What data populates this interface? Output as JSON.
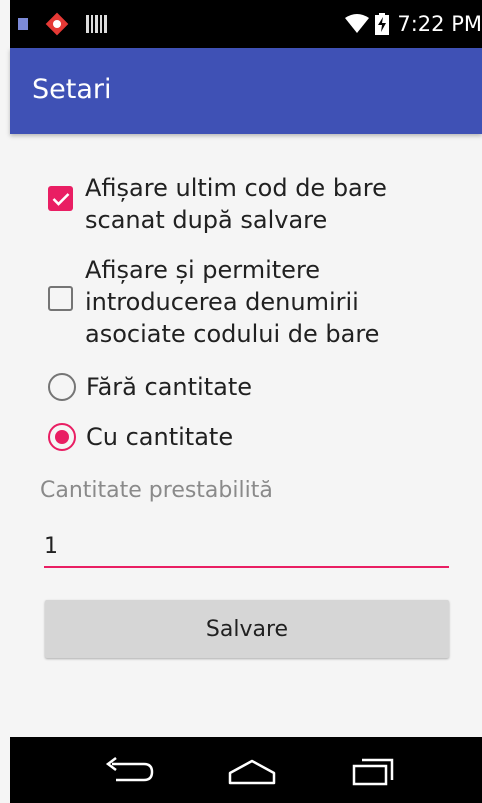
{
  "status_bar": {
    "time": "7:22 PM",
    "icons": [
      "notification-square-icon",
      "app-diamond-icon",
      "barcode-icon",
      "wifi-icon",
      "battery-charging-icon"
    ]
  },
  "app_bar": {
    "title": "Setari"
  },
  "settings": {
    "checkbox_last_code": {
      "lines": [
        "Afișare ultim cod de bare",
        "scanat după salvare"
      ],
      "checked": true
    },
    "checkbox_name_entry": {
      "lines": [
        "Afișare și permitere",
        "introducerea denumirii",
        "asociate codului de bare"
      ],
      "checked": false
    },
    "radio_no_quantity": {
      "label": "Fără cantitate",
      "selected": false
    },
    "radio_with_quantity": {
      "label": "Cu cantitate",
      "selected": true
    },
    "default_quantity": {
      "label": "Cantitate prestabilită",
      "value": "1"
    },
    "save_label": "Salvare"
  },
  "nav_bar": {
    "icons": [
      "back-icon",
      "home-icon",
      "recents-icon"
    ]
  },
  "colors": {
    "primary": "#3f51b5",
    "accent": "#e91e63",
    "background": "#f5f5f5"
  }
}
